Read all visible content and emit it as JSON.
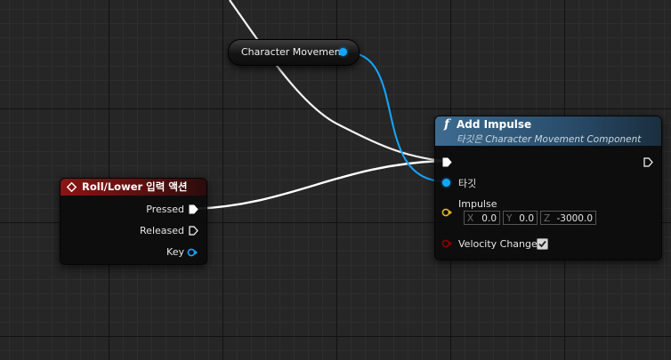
{
  "variable_node": {
    "label": "Character Movement",
    "pin_color": "#14a6ff"
  },
  "input_node": {
    "title": "Roll/Lower 입력 액션",
    "header_color": "#8c1414",
    "pins": {
      "pressed": "Pressed",
      "released": "Released",
      "key": "Key"
    }
  },
  "function_node": {
    "title": "Add Impulse",
    "subtitle": "타깃은 Character Movement Component",
    "header_color": "#3d6b8f",
    "target_label": "타깃",
    "impulse_label": "Impulse",
    "impulse": {
      "x_axis": "X",
      "x_value": "0.0",
      "y_axis": "Y",
      "y_value": "0.0",
      "z_axis": "Z",
      "z_value": "-3000.0"
    },
    "velocity_change_label": "Velocity Change",
    "velocity_change_checked": true,
    "vector_pin_color": "#e6b42a",
    "bool_pin_color": "#8c0000"
  },
  "wire_colors": {
    "exec": "#ffffff",
    "object": "#14a6ff"
  }
}
